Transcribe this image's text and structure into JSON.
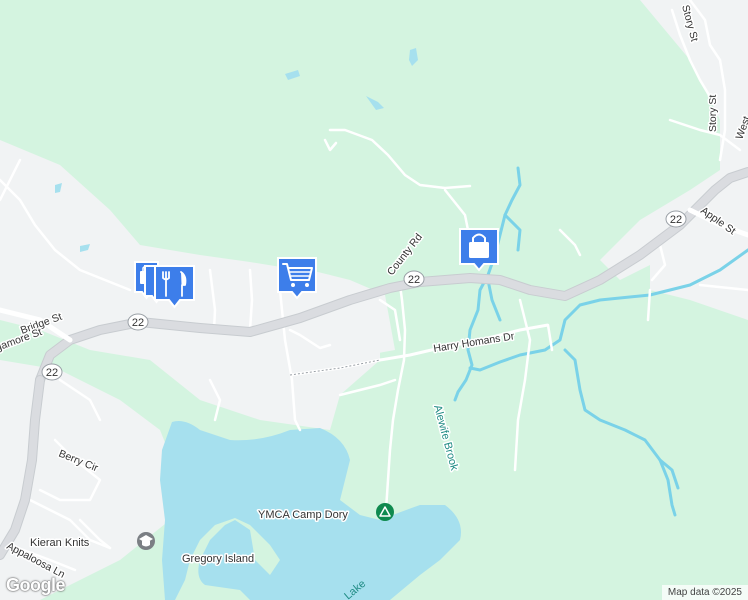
{
  "map": {
    "colors": {
      "land": "#e8f5ee",
      "forest": "#d4f4e0",
      "developed": "#f1f3f4",
      "water": "#a6e0ee",
      "road": "#ffffff",
      "road_casing": "#c8ccd0",
      "highway": "#dadce0",
      "stream": "#7ad2e8",
      "route_shield_border": "#9aa0a6",
      "poi_marker": "#3d7eea",
      "park_marker": "#0f8a4f",
      "generic_marker": "#7b7f84"
    },
    "roads": [
      {
        "id": "route-22",
        "name": "22",
        "type": "state route"
      },
      {
        "id": "county-rd",
        "name": "County Rd"
      },
      {
        "id": "harry-homans-dr",
        "name": "Harry Homans Dr"
      },
      {
        "id": "bridge-st",
        "name": "Bridge St"
      },
      {
        "id": "sagamore-st",
        "name": "Sagamore St"
      },
      {
        "id": "berry-cir",
        "name": "Berry Cir"
      },
      {
        "id": "appaloosa-ln",
        "name": "Appaloosa Ln"
      },
      {
        "id": "story-st-1",
        "name": "Story St"
      },
      {
        "id": "story-st-2",
        "name": "Story St"
      },
      {
        "id": "apple-st",
        "name": "Apple St"
      },
      {
        "id": "west-st",
        "name": "West"
      }
    ],
    "route_shields": [
      "22",
      "22",
      "22",
      "22"
    ],
    "water_labels": {
      "brook": "Alewife Brook",
      "lake": "Lake"
    },
    "places": {
      "camp": "YMCA Camp Dory",
      "island": "Gregory Island",
      "shop": "Kieran Knits"
    },
    "markers": [
      {
        "id": "shopping-marker-left",
        "icon": "shopping-bag-icon"
      },
      {
        "id": "restaurant-marker",
        "icon": "fork-knife-icon"
      },
      {
        "id": "grocery-marker",
        "icon": "shopping-cart-icon"
      },
      {
        "id": "shopping-marker-right",
        "icon": "shopping-bag-icon"
      },
      {
        "id": "camp-marker",
        "icon": "tent-icon"
      },
      {
        "id": "shop-marker",
        "icon": "graduation-cap-icon"
      }
    ],
    "attribution": "Map data ©2025",
    "logo": "Google"
  }
}
